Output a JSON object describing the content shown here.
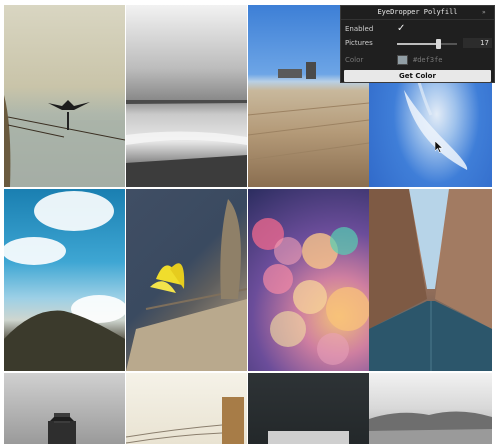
{
  "panel": {
    "title": "EyeDropper Polyfill",
    "collapse_glyph": "»",
    "enabled_label": "Enabled",
    "enabled_checked": true,
    "pictures_label": "Pictures",
    "pictures_value": "17",
    "pictures_slider_fraction": 0.68,
    "color_label": "Color",
    "color_value": "#def3fe",
    "button_label": "Get Color"
  },
  "gallery": {
    "images": [
      {
        "name": "cormorant-pier"
      },
      {
        "name": "bw-beach-clouds"
      },
      {
        "name": "pier-boardwalk"
      },
      {
        "name": "blue-sky-wisp"
      },
      {
        "name": "sky-rock-people"
      },
      {
        "name": "yellow-leaf-wood"
      },
      {
        "name": "bokeh-lights"
      },
      {
        "name": "city-street"
      },
      {
        "name": "lighthouse-bw"
      },
      {
        "name": "wooden-post"
      },
      {
        "name": "dark-surface"
      },
      {
        "name": "coastal-hills"
      }
    ]
  },
  "icons": {
    "checkmark": "✓",
    "cursor": "arrow-cursor-icon"
  }
}
